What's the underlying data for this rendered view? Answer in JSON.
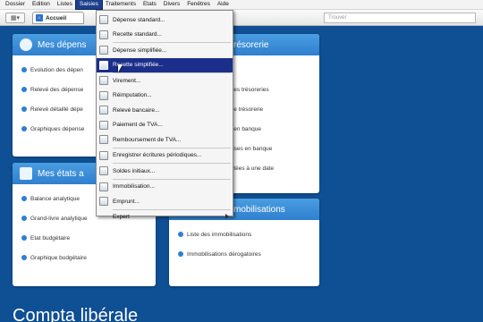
{
  "menubar": [
    "Dossier",
    "Edition",
    "Listes",
    "Saisies",
    "Traitements",
    "Etats",
    "Divers",
    "Fenêtres",
    "Aide"
  ],
  "toolbar": {
    "tab_label": "Accueil",
    "search_placeholder": "Trouver"
  },
  "panels": {
    "p1": {
      "title": "Mes dépens",
      "items": [
        "Evolution des dépen",
        "Relevé des dépense",
        "Relevé détaillé dépe",
        "Graphiques dépense"
      ]
    },
    "p2": {
      "title": "résorerie",
      "items": [
        "",
        "postes trésoreries",
        "nique trésorerie",
        "nes en banque",
        "remises en banque",
        "pointées à une date"
      ]
    },
    "p3": {
      "title": "Mes états a",
      "items": [
        "Balance analytique",
        "Grand-livre analytique",
        "Etat budgétaire",
        "Graphique budgétaire"
      ]
    },
    "p4": {
      "title": "mobilisations",
      "items": [
        "Liste des immobilisations",
        "Immobilisations dérogatoires"
      ]
    }
  },
  "footer_title": "Compta libérale",
  "dropdown": [
    {
      "label": "Dépense standard...",
      "icon": "expense-icon"
    },
    {
      "label": "Recette standard...",
      "icon": "receipt-icon"
    },
    {
      "sep": true
    },
    {
      "label": "Dépense simplifiée...",
      "icon": "expense-simple-icon"
    },
    {
      "label": "Recette simplifiée...",
      "icon": "receipt-simple-icon",
      "highlight": true
    },
    {
      "sep": true
    },
    {
      "label": "Virement...",
      "icon": "transfer-icon"
    },
    {
      "label": "Réimputation...",
      "icon": "reassign-icon"
    },
    {
      "label": "Relevé bancaire...",
      "icon": "bank-statement-icon"
    },
    {
      "label": "Paiement de TVA...",
      "icon": "vat-payment-icon"
    },
    {
      "label": "Remboursement de TVA...",
      "icon": "vat-refund-icon"
    },
    {
      "sep": true
    },
    {
      "label": "Enregistrer écritures périodiques...",
      "icon": "recurring-icon"
    },
    {
      "sep": true
    },
    {
      "label": "Soldes initiaux...",
      "icon": "balance-icon"
    },
    {
      "sep": true
    },
    {
      "label": "Immobilisation...",
      "icon": "asset-icon"
    },
    {
      "label": "Emprunt...",
      "icon": "loan-icon"
    },
    {
      "sep": true
    },
    {
      "label": "Expert",
      "icon": "",
      "submenu": true
    }
  ],
  "colors": {
    "background": "#0f4f93",
    "header": "#2f7fcf",
    "highlight": "#1b2f8a"
  }
}
